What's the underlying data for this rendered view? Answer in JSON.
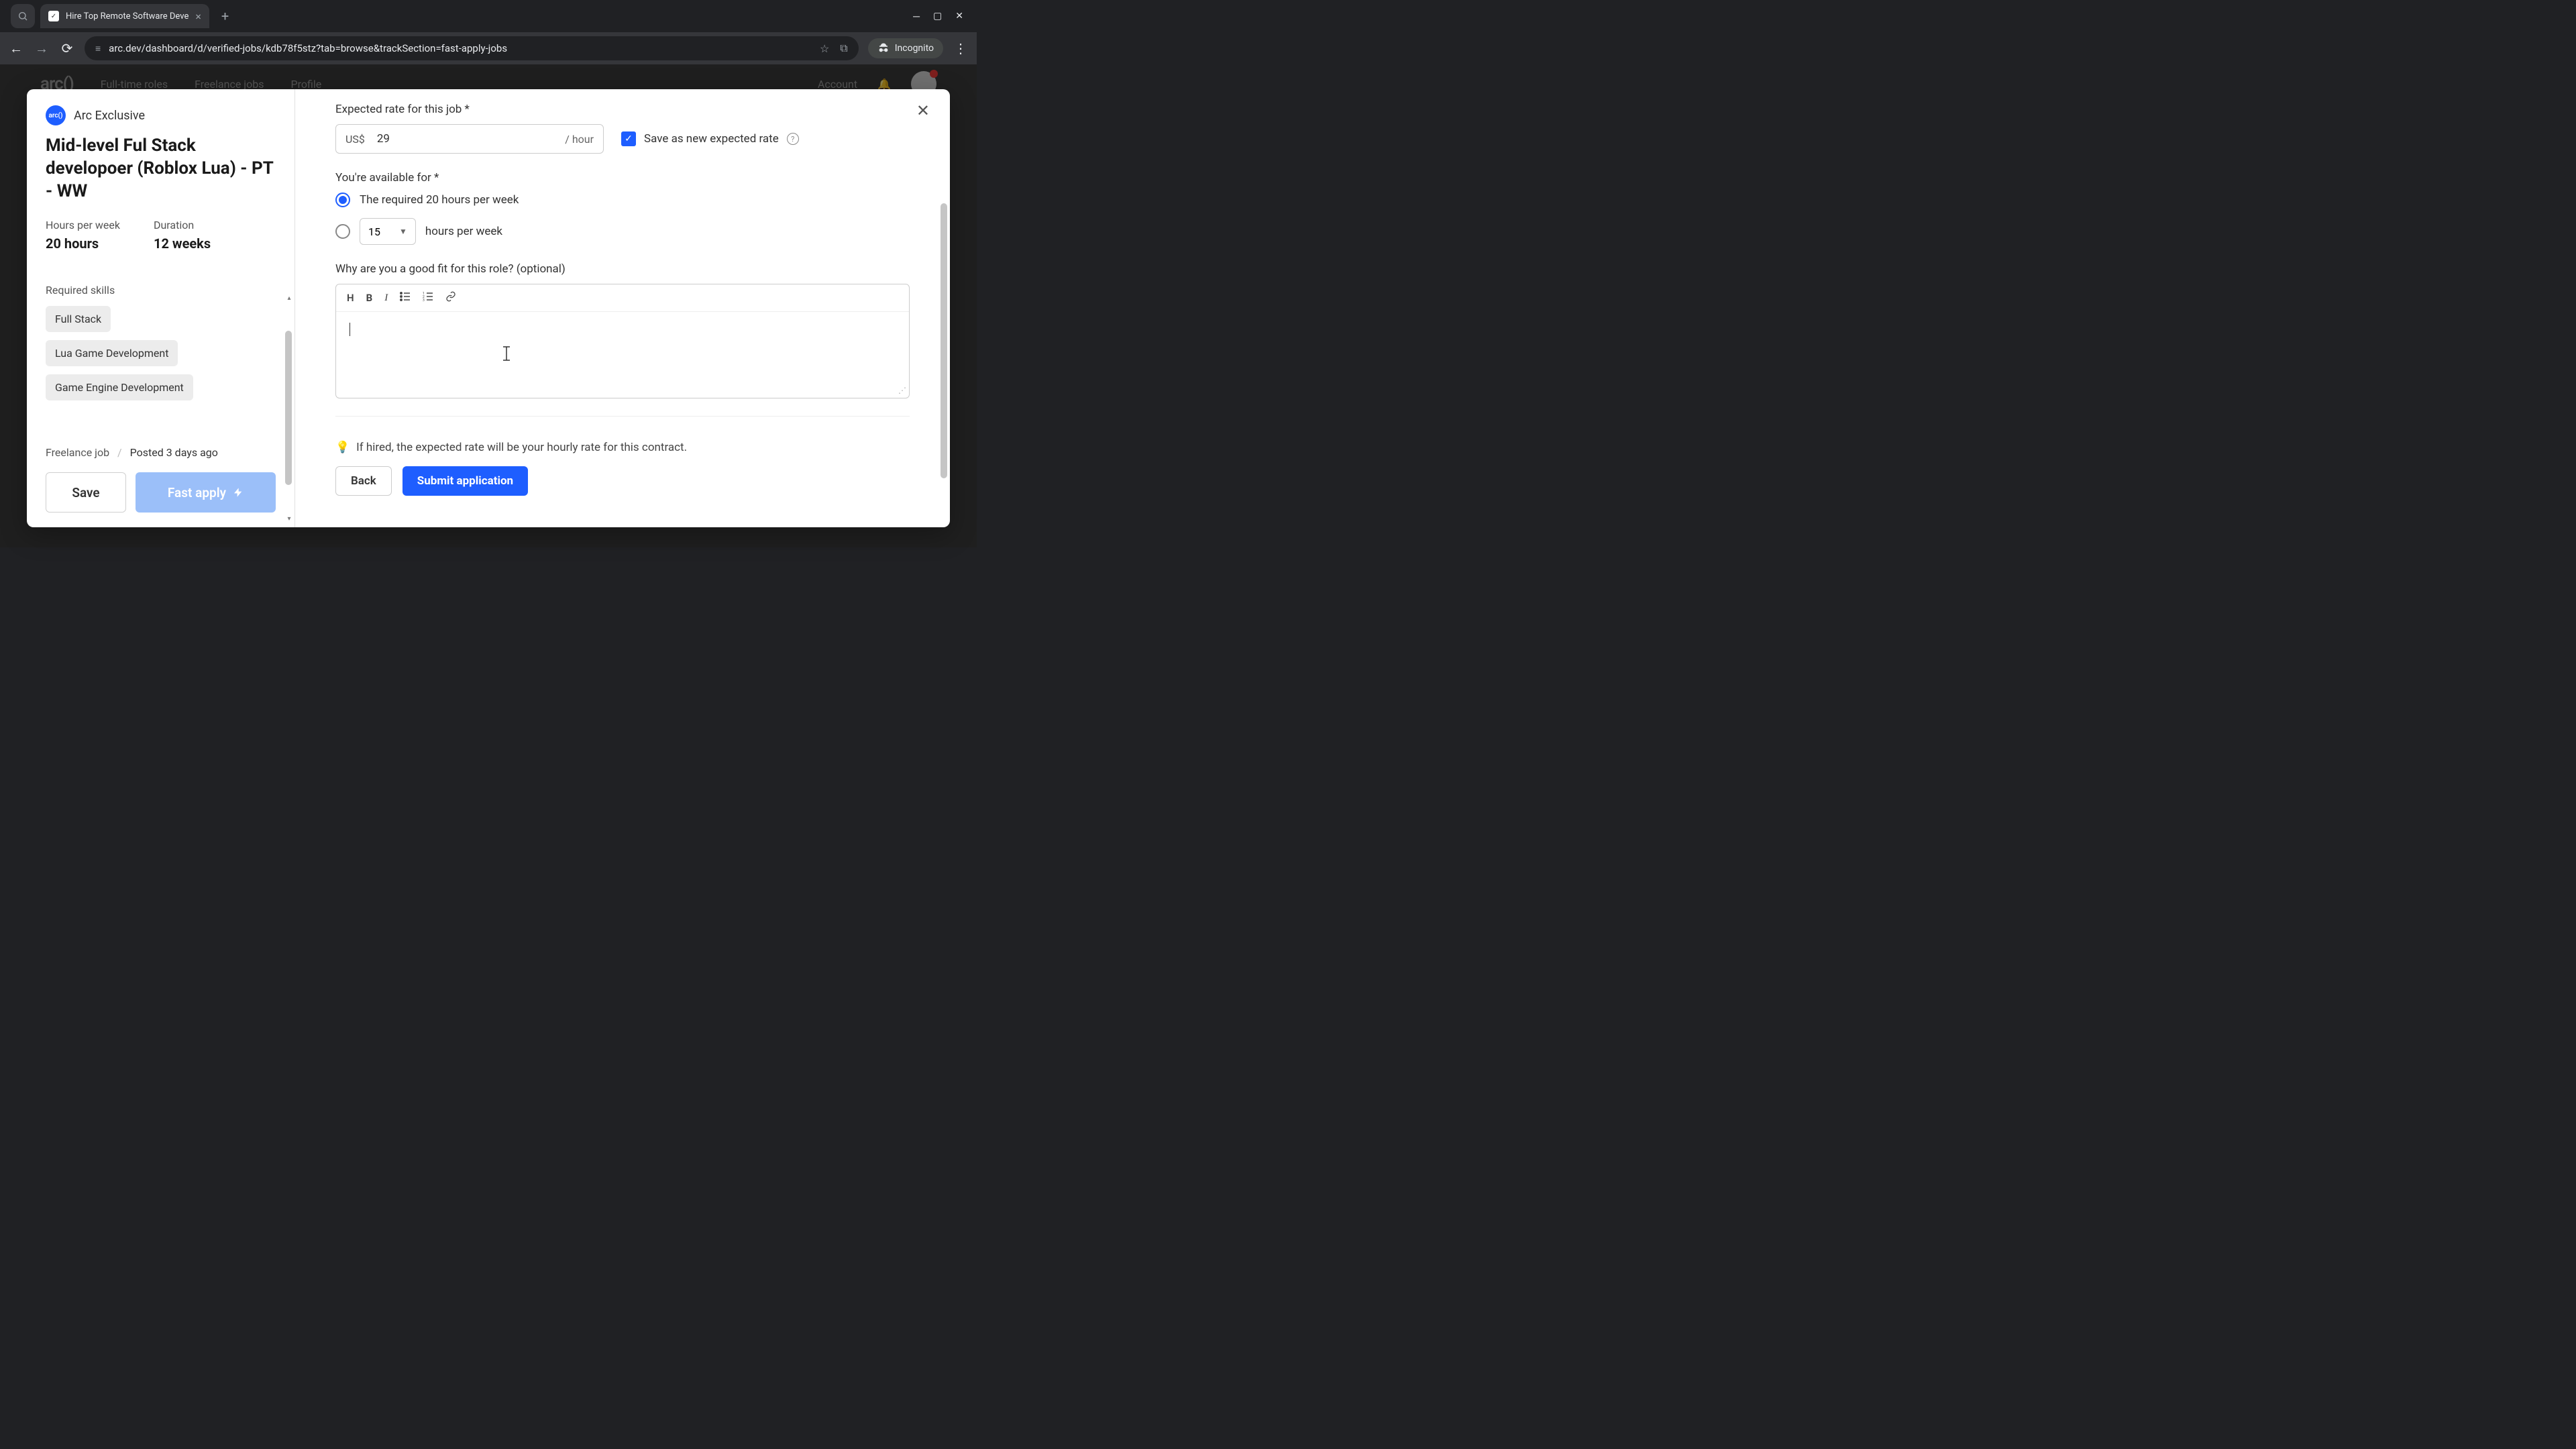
{
  "browser": {
    "tab_title": "Hire Top Remote Software Deve",
    "url": "arc.dev/dashboard/d/verified-jobs/kdb78f5stz?tab=browse&trackSection=fast-apply-jobs",
    "incognito_label": "Incognito"
  },
  "background_nav": {
    "logo": "arc()",
    "items": [
      "Full-time roles",
      "Freelance jobs",
      "Profile"
    ],
    "right": [
      "Account"
    ]
  },
  "sidebar": {
    "company_badge": "arc()",
    "company_name": "Arc Exclusive",
    "job_title": "Mid-level Ful Stack developoer (Roblox Lua) - PT - WW",
    "hours_label": "Hours per week",
    "hours_value": "20 hours",
    "duration_label": "Duration",
    "duration_value": "12 weeks",
    "skills_label": "Required skills",
    "skills": [
      "Full Stack",
      "Lua Game Development",
      "Game Engine Development"
    ],
    "job_type": "Freelance job",
    "posted": "Posted 3 days ago",
    "save_btn": "Save",
    "fast_apply_btn": "Fast apply"
  },
  "form": {
    "rate_label": "Expected rate for this job *",
    "currency": "US$",
    "rate_value": "29",
    "rate_suffix": "/ hour",
    "save_rate_label": "Save as new expected rate",
    "avail_label": "You're available for *",
    "avail_option_required": "The required 20 hours per week",
    "avail_custom_value": "15",
    "avail_custom_suffix": "hours per week",
    "fit_label": "Why are you a good fit for this role? (optional)",
    "hint": "If hired, the expected rate will be your hourly rate for this contract.",
    "back_btn": "Back",
    "submit_btn": "Submit application"
  }
}
